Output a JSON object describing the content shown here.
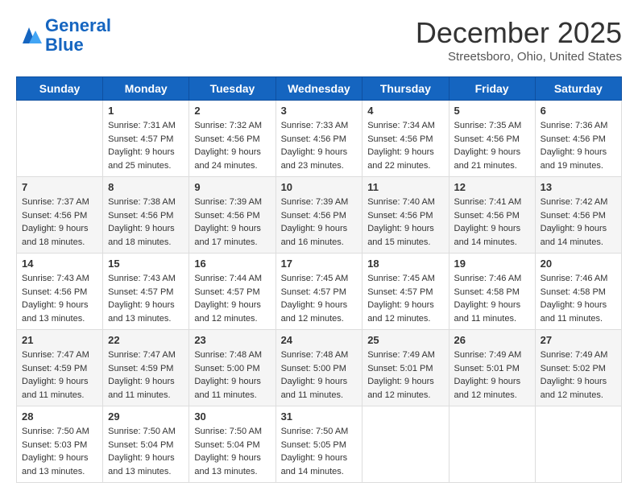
{
  "logo": {
    "line1": "General",
    "line2": "Blue"
  },
  "title": "December 2025",
  "location": "Streetsboro, Ohio, United States",
  "days_of_week": [
    "Sunday",
    "Monday",
    "Tuesday",
    "Wednesday",
    "Thursday",
    "Friday",
    "Saturday"
  ],
  "weeks": [
    [
      {
        "day": "",
        "sunrise": "",
        "sunset": "",
        "daylight": ""
      },
      {
        "day": "1",
        "sunrise": "Sunrise: 7:31 AM",
        "sunset": "Sunset: 4:57 PM",
        "daylight": "Daylight: 9 hours and 25 minutes."
      },
      {
        "day": "2",
        "sunrise": "Sunrise: 7:32 AM",
        "sunset": "Sunset: 4:56 PM",
        "daylight": "Daylight: 9 hours and 24 minutes."
      },
      {
        "day": "3",
        "sunrise": "Sunrise: 7:33 AM",
        "sunset": "Sunset: 4:56 PM",
        "daylight": "Daylight: 9 hours and 23 minutes."
      },
      {
        "day": "4",
        "sunrise": "Sunrise: 7:34 AM",
        "sunset": "Sunset: 4:56 PM",
        "daylight": "Daylight: 9 hours and 22 minutes."
      },
      {
        "day": "5",
        "sunrise": "Sunrise: 7:35 AM",
        "sunset": "Sunset: 4:56 PM",
        "daylight": "Daylight: 9 hours and 21 minutes."
      },
      {
        "day": "6",
        "sunrise": "Sunrise: 7:36 AM",
        "sunset": "Sunset: 4:56 PM",
        "daylight": "Daylight: 9 hours and 19 minutes."
      }
    ],
    [
      {
        "day": "7",
        "sunrise": "Sunrise: 7:37 AM",
        "sunset": "Sunset: 4:56 PM",
        "daylight": "Daylight: 9 hours and 18 minutes."
      },
      {
        "day": "8",
        "sunrise": "Sunrise: 7:38 AM",
        "sunset": "Sunset: 4:56 PM",
        "daylight": "Daylight: 9 hours and 18 minutes."
      },
      {
        "day": "9",
        "sunrise": "Sunrise: 7:39 AM",
        "sunset": "Sunset: 4:56 PM",
        "daylight": "Daylight: 9 hours and 17 minutes."
      },
      {
        "day": "10",
        "sunrise": "Sunrise: 7:39 AM",
        "sunset": "Sunset: 4:56 PM",
        "daylight": "Daylight: 9 hours and 16 minutes."
      },
      {
        "day": "11",
        "sunrise": "Sunrise: 7:40 AM",
        "sunset": "Sunset: 4:56 PM",
        "daylight": "Daylight: 9 hours and 15 minutes."
      },
      {
        "day": "12",
        "sunrise": "Sunrise: 7:41 AM",
        "sunset": "Sunset: 4:56 PM",
        "daylight": "Daylight: 9 hours and 14 minutes."
      },
      {
        "day": "13",
        "sunrise": "Sunrise: 7:42 AM",
        "sunset": "Sunset: 4:56 PM",
        "daylight": "Daylight: 9 hours and 14 minutes."
      }
    ],
    [
      {
        "day": "14",
        "sunrise": "Sunrise: 7:43 AM",
        "sunset": "Sunset: 4:56 PM",
        "daylight": "Daylight: 9 hours and 13 minutes."
      },
      {
        "day": "15",
        "sunrise": "Sunrise: 7:43 AM",
        "sunset": "Sunset: 4:57 PM",
        "daylight": "Daylight: 9 hours and 13 minutes."
      },
      {
        "day": "16",
        "sunrise": "Sunrise: 7:44 AM",
        "sunset": "Sunset: 4:57 PM",
        "daylight": "Daylight: 9 hours and 12 minutes."
      },
      {
        "day": "17",
        "sunrise": "Sunrise: 7:45 AM",
        "sunset": "Sunset: 4:57 PM",
        "daylight": "Daylight: 9 hours and 12 minutes."
      },
      {
        "day": "18",
        "sunrise": "Sunrise: 7:45 AM",
        "sunset": "Sunset: 4:57 PM",
        "daylight": "Daylight: 9 hours and 12 minutes."
      },
      {
        "day": "19",
        "sunrise": "Sunrise: 7:46 AM",
        "sunset": "Sunset: 4:58 PM",
        "daylight": "Daylight: 9 hours and 11 minutes."
      },
      {
        "day": "20",
        "sunrise": "Sunrise: 7:46 AM",
        "sunset": "Sunset: 4:58 PM",
        "daylight": "Daylight: 9 hours and 11 minutes."
      }
    ],
    [
      {
        "day": "21",
        "sunrise": "Sunrise: 7:47 AM",
        "sunset": "Sunset: 4:59 PM",
        "daylight": "Daylight: 9 hours and 11 minutes."
      },
      {
        "day": "22",
        "sunrise": "Sunrise: 7:47 AM",
        "sunset": "Sunset: 4:59 PM",
        "daylight": "Daylight: 9 hours and 11 minutes."
      },
      {
        "day": "23",
        "sunrise": "Sunrise: 7:48 AM",
        "sunset": "Sunset: 5:00 PM",
        "daylight": "Daylight: 9 hours and 11 minutes."
      },
      {
        "day": "24",
        "sunrise": "Sunrise: 7:48 AM",
        "sunset": "Sunset: 5:00 PM",
        "daylight": "Daylight: 9 hours and 11 minutes."
      },
      {
        "day": "25",
        "sunrise": "Sunrise: 7:49 AM",
        "sunset": "Sunset: 5:01 PM",
        "daylight": "Daylight: 9 hours and 12 minutes."
      },
      {
        "day": "26",
        "sunrise": "Sunrise: 7:49 AM",
        "sunset": "Sunset: 5:01 PM",
        "daylight": "Daylight: 9 hours and 12 minutes."
      },
      {
        "day": "27",
        "sunrise": "Sunrise: 7:49 AM",
        "sunset": "Sunset: 5:02 PM",
        "daylight": "Daylight: 9 hours and 12 minutes."
      }
    ],
    [
      {
        "day": "28",
        "sunrise": "Sunrise: 7:50 AM",
        "sunset": "Sunset: 5:03 PM",
        "daylight": "Daylight: 9 hours and 13 minutes."
      },
      {
        "day": "29",
        "sunrise": "Sunrise: 7:50 AM",
        "sunset": "Sunset: 5:04 PM",
        "daylight": "Daylight: 9 hours and 13 minutes."
      },
      {
        "day": "30",
        "sunrise": "Sunrise: 7:50 AM",
        "sunset": "Sunset: 5:04 PM",
        "daylight": "Daylight: 9 hours and 13 minutes."
      },
      {
        "day": "31",
        "sunrise": "Sunrise: 7:50 AM",
        "sunset": "Sunset: 5:05 PM",
        "daylight": "Daylight: 9 hours and 14 minutes."
      },
      {
        "day": "",
        "sunrise": "",
        "sunset": "",
        "daylight": ""
      },
      {
        "day": "",
        "sunrise": "",
        "sunset": "",
        "daylight": ""
      },
      {
        "day": "",
        "sunrise": "",
        "sunset": "",
        "daylight": ""
      }
    ]
  ]
}
